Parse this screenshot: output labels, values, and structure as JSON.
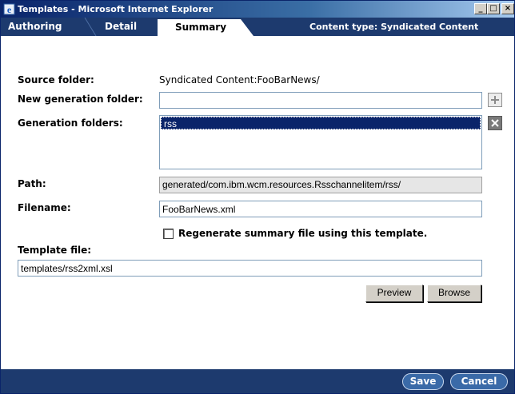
{
  "window": {
    "title": "Templates - Microsoft Internet Explorer",
    "minimize_glyph": "_",
    "maximize_glyph": "□",
    "close_glyph": "×"
  },
  "tabs": {
    "items": [
      {
        "label": "Authoring",
        "active": false
      },
      {
        "label": "Detail",
        "active": false
      },
      {
        "label": "Summary",
        "active": true
      }
    ],
    "content_type": "Content type: Syndicated Content"
  },
  "form": {
    "source_folder": {
      "label": "Source folder:",
      "value": "Syndicated Content:FooBarNews/"
    },
    "new_generation_folder": {
      "label": "New generation folder:",
      "value": ""
    },
    "generation_folders": {
      "label": "Generation folders:",
      "items": [
        "rss"
      ],
      "selected": "rss"
    },
    "path": {
      "label": "Path:",
      "value": "generated/com.ibm.wcm.resources.Rsschannelitem/rss/"
    },
    "filename": {
      "label": "Filename:",
      "value": "FooBarNews.xml"
    },
    "regenerate": {
      "label": "Regenerate summary file using this template.",
      "checked": false
    },
    "template_file": {
      "label": "Template file:",
      "value": "templates/rss2xml.xsl"
    }
  },
  "buttons": {
    "preview": "Preview",
    "browse": "Browse",
    "save": "Save",
    "cancel": "Cancel"
  },
  "icons": {
    "add": "plus-icon",
    "remove": "x-icon",
    "window": "ie-icon"
  },
  "colors": {
    "title_gradient_start": "#0a246a",
    "tab_bar": "#1d3a6e",
    "active_tab": "#ffffff",
    "selection": "#0a246a",
    "button_face": "#d4d0c8",
    "pill_button": "#3a6aa8"
  }
}
